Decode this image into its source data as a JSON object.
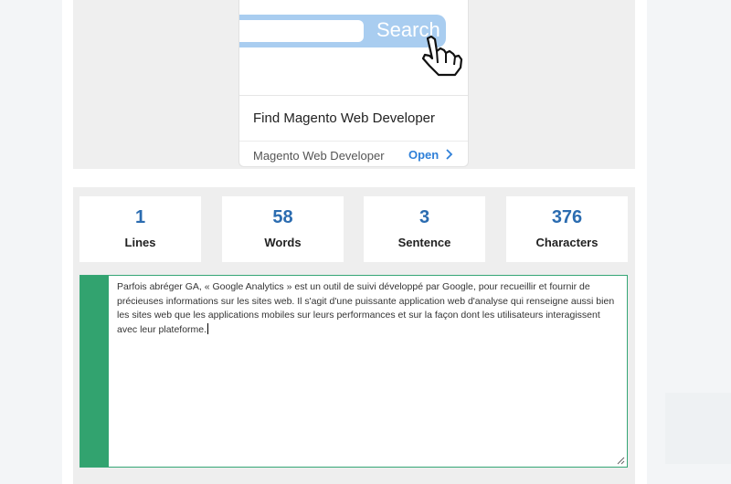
{
  "ad": {
    "image_search_label": "Search",
    "title": "Find Magento Web Developer",
    "advertiser": "Magento Web Developer",
    "open_label": "Open"
  },
  "stats": [
    {
      "value": "1",
      "label": "Lines"
    },
    {
      "value": "58",
      "label": "Words"
    },
    {
      "value": "3",
      "label": "Sentence"
    },
    {
      "value": "376",
      "label": "Characters"
    }
  ],
  "editor": {
    "text": " Parfois abréger GA, « Google Analytics » est un outil de suivi développé par Google, pour recueillir et fournir de précieuses informations sur les sites web. Il s'agit d'une puissante application web d'analyse qui renseigne aussi bien les sites web que les applications mobiles sur leurs performances et sur la façon dont les utilisateurs interagissent avec leur plateforme."
  },
  "colors": {
    "accent_blue": "#2b6cb0",
    "gutter_green": "#32a36f",
    "open_link": "#2f80d8"
  }
}
